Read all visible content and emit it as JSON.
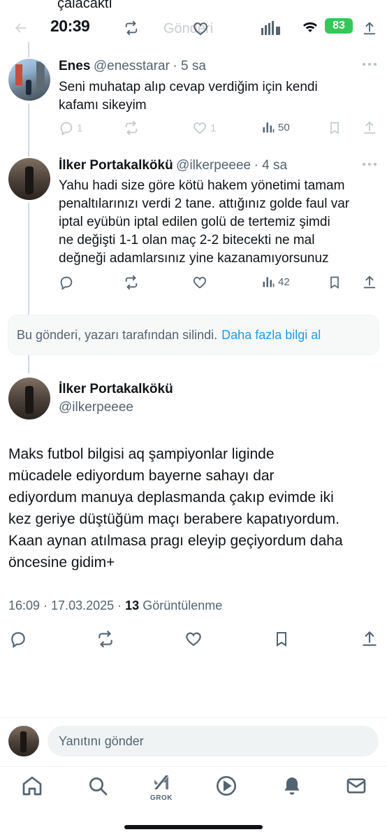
{
  "header": {
    "top_cut_text": "çalacaktı",
    "time": "20:39",
    "faded_label": "Gönderi",
    "battery": "83"
  },
  "tweets": [
    {
      "name": "Enes",
      "handle": "@enesstarar",
      "age": "· 5 sa",
      "text_lines": [
        "Seni muhatap alıp cevap verdiğim için kendi",
        "kafamı sikeyim"
      ],
      "replies": "1",
      "likes": "1",
      "views": "50"
    },
    {
      "name": "İlker Portakalkökü",
      "handle": "@ilkerpeeee",
      "age": "· 4 sa",
      "text_lines": [
        "Yahu hadi size göre kötü hakem yönetimi tamam",
        "penaltılarınızı verdi 2 tane. attığınız golde faul var",
        "iptal eyübün iptal edilen golü de tertemiz şimdi",
        "ne değişti 1-1 olan maç 2-2 bitecekti ne mal",
        "değneği adamlarsınız yine kazanamıyorsunuz"
      ],
      "views": "42"
    }
  ],
  "deleted_notice": {
    "text": "Bu gönderi, yazarı tarafından silindi.",
    "link": "Daha fazla bilgi al"
  },
  "main_tweet": {
    "name": "İlker Portakalkökü",
    "handle": "@ilkerpeeee",
    "text_lines": [
      "Maks futbol bilgisi aq şampiyonlar liginde",
      "mücadele ediyordum bayerne sahayı dar",
      "ediyordum manuya deplasmanda çakıp evimde iki",
      "kez geriye düştüğüm maçı berabere kapatıyordum.",
      "Kaan aynan atılmasa pragı eleyip geçiyordum daha",
      "öncesine gidim+"
    ],
    "timestamp": "16:09 · 17.03.2025 ·",
    "views_count": "13",
    "views_label": "Görüntülenme"
  },
  "reply": {
    "placeholder": "Yanıtını gönder"
  },
  "tabbar": {
    "grok_label": "GROK"
  },
  "icons": [
    "back-icon",
    "repost-icon",
    "like-icon",
    "signal-icon",
    "wifi-icon",
    "share-icon",
    "reply-icon",
    "views-icon",
    "bookmark-icon",
    "more-icon",
    "home-icon",
    "search-icon",
    "grok-icon",
    "play-icon",
    "bell-icon",
    "mail-icon"
  ],
  "colors": {
    "link": "#1d9bf0",
    "muted": "#536471",
    "text": "#0f1419",
    "battery": "#34c759"
  }
}
